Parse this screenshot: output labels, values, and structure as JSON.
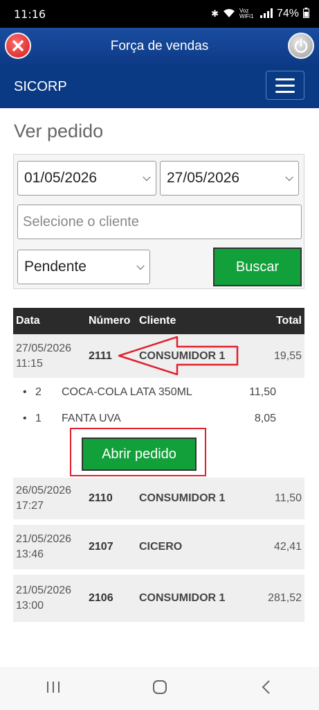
{
  "status_bar": {
    "time": "11:16",
    "icons_text": "Voz WiFi1",
    "battery": "74%"
  },
  "app_bar": {
    "title": "Força de vendas"
  },
  "nav_bar": {
    "brand": "SICORP"
  },
  "page": {
    "title": "Ver pedido"
  },
  "filters": {
    "date_from": "01/05/2026",
    "date_to": "27/05/2026",
    "client_placeholder": "Selecione o cliente",
    "status": "Pendente",
    "search_label": "Buscar"
  },
  "table": {
    "headers": [
      "Data",
      "Número",
      "Cliente",
      "Total"
    ],
    "rows": [
      {
        "date": "27/05/2026",
        "time": "11:15",
        "number": "2111",
        "client": "CONSUMIDOR 1",
        "total": "19,55"
      },
      {
        "date": "26/05/2026",
        "time": "17:27",
        "number": "2110",
        "client": "CONSUMIDOR 1",
        "total": "11,50"
      },
      {
        "date": "21/05/2026",
        "time": "13:46",
        "number": "2107",
        "client": "CICERO",
        "total": "42,41"
      },
      {
        "date": "21/05/2026",
        "time": "13:00",
        "number": "2106",
        "client": "CONSUMIDOR 1",
        "total": "281,52"
      }
    ]
  },
  "order_items": [
    {
      "bullet": "•",
      "qty": "2",
      "desc": "COCA-COLA LATA 350ML",
      "value": "11,50"
    },
    {
      "bullet": "•",
      "qty": "1",
      "desc": "FANTA UVA",
      "value": "8,05"
    }
  ],
  "open_order_label": "Abrir pedido",
  "colors": {
    "app_bar": "#0d3a86",
    "button_green": "#12a03a",
    "annotation_red": "#e0202e",
    "table_header": "#2b2b2b"
  }
}
